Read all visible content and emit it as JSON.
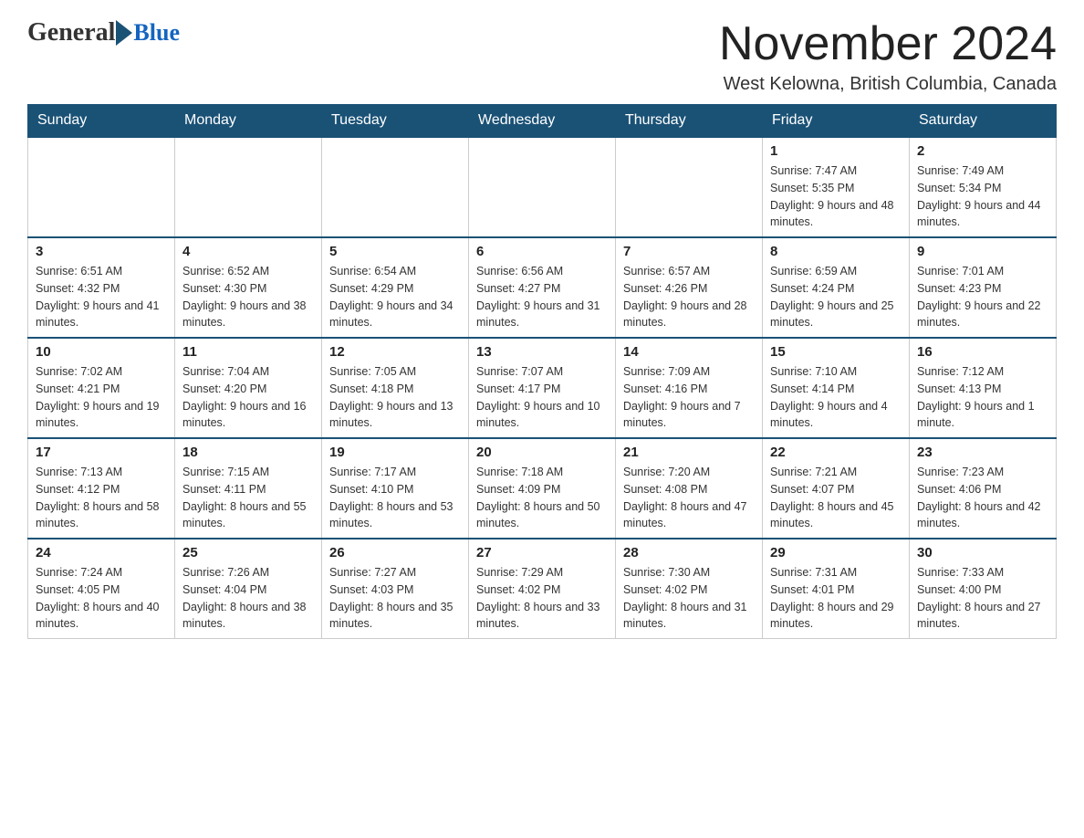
{
  "header": {
    "month_title": "November 2024",
    "location": "West Kelowna, British Columbia, Canada"
  },
  "logo": {
    "part1": "General",
    "part2": "Blue"
  },
  "weekdays": [
    "Sunday",
    "Monday",
    "Tuesday",
    "Wednesday",
    "Thursday",
    "Friday",
    "Saturday"
  ],
  "weeks": [
    [
      {
        "day": "",
        "sunrise": "",
        "sunset": "",
        "daylight": ""
      },
      {
        "day": "",
        "sunrise": "",
        "sunset": "",
        "daylight": ""
      },
      {
        "day": "",
        "sunrise": "",
        "sunset": "",
        "daylight": ""
      },
      {
        "day": "",
        "sunrise": "",
        "sunset": "",
        "daylight": ""
      },
      {
        "day": "",
        "sunrise": "",
        "sunset": "",
        "daylight": ""
      },
      {
        "day": "1",
        "sunrise": "Sunrise: 7:47 AM",
        "sunset": "Sunset: 5:35 PM",
        "daylight": "Daylight: 9 hours and 48 minutes."
      },
      {
        "day": "2",
        "sunrise": "Sunrise: 7:49 AM",
        "sunset": "Sunset: 5:34 PM",
        "daylight": "Daylight: 9 hours and 44 minutes."
      }
    ],
    [
      {
        "day": "3",
        "sunrise": "Sunrise: 6:51 AM",
        "sunset": "Sunset: 4:32 PM",
        "daylight": "Daylight: 9 hours and 41 minutes."
      },
      {
        "day": "4",
        "sunrise": "Sunrise: 6:52 AM",
        "sunset": "Sunset: 4:30 PM",
        "daylight": "Daylight: 9 hours and 38 minutes."
      },
      {
        "day": "5",
        "sunrise": "Sunrise: 6:54 AM",
        "sunset": "Sunset: 4:29 PM",
        "daylight": "Daylight: 9 hours and 34 minutes."
      },
      {
        "day": "6",
        "sunrise": "Sunrise: 6:56 AM",
        "sunset": "Sunset: 4:27 PM",
        "daylight": "Daylight: 9 hours and 31 minutes."
      },
      {
        "day": "7",
        "sunrise": "Sunrise: 6:57 AM",
        "sunset": "Sunset: 4:26 PM",
        "daylight": "Daylight: 9 hours and 28 minutes."
      },
      {
        "day": "8",
        "sunrise": "Sunrise: 6:59 AM",
        "sunset": "Sunset: 4:24 PM",
        "daylight": "Daylight: 9 hours and 25 minutes."
      },
      {
        "day": "9",
        "sunrise": "Sunrise: 7:01 AM",
        "sunset": "Sunset: 4:23 PM",
        "daylight": "Daylight: 9 hours and 22 minutes."
      }
    ],
    [
      {
        "day": "10",
        "sunrise": "Sunrise: 7:02 AM",
        "sunset": "Sunset: 4:21 PM",
        "daylight": "Daylight: 9 hours and 19 minutes."
      },
      {
        "day": "11",
        "sunrise": "Sunrise: 7:04 AM",
        "sunset": "Sunset: 4:20 PM",
        "daylight": "Daylight: 9 hours and 16 minutes."
      },
      {
        "day": "12",
        "sunrise": "Sunrise: 7:05 AM",
        "sunset": "Sunset: 4:18 PM",
        "daylight": "Daylight: 9 hours and 13 minutes."
      },
      {
        "day": "13",
        "sunrise": "Sunrise: 7:07 AM",
        "sunset": "Sunset: 4:17 PM",
        "daylight": "Daylight: 9 hours and 10 minutes."
      },
      {
        "day": "14",
        "sunrise": "Sunrise: 7:09 AM",
        "sunset": "Sunset: 4:16 PM",
        "daylight": "Daylight: 9 hours and 7 minutes."
      },
      {
        "day": "15",
        "sunrise": "Sunrise: 7:10 AM",
        "sunset": "Sunset: 4:14 PM",
        "daylight": "Daylight: 9 hours and 4 minutes."
      },
      {
        "day": "16",
        "sunrise": "Sunrise: 7:12 AM",
        "sunset": "Sunset: 4:13 PM",
        "daylight": "Daylight: 9 hours and 1 minute."
      }
    ],
    [
      {
        "day": "17",
        "sunrise": "Sunrise: 7:13 AM",
        "sunset": "Sunset: 4:12 PM",
        "daylight": "Daylight: 8 hours and 58 minutes."
      },
      {
        "day": "18",
        "sunrise": "Sunrise: 7:15 AM",
        "sunset": "Sunset: 4:11 PM",
        "daylight": "Daylight: 8 hours and 55 minutes."
      },
      {
        "day": "19",
        "sunrise": "Sunrise: 7:17 AM",
        "sunset": "Sunset: 4:10 PM",
        "daylight": "Daylight: 8 hours and 53 minutes."
      },
      {
        "day": "20",
        "sunrise": "Sunrise: 7:18 AM",
        "sunset": "Sunset: 4:09 PM",
        "daylight": "Daylight: 8 hours and 50 minutes."
      },
      {
        "day": "21",
        "sunrise": "Sunrise: 7:20 AM",
        "sunset": "Sunset: 4:08 PM",
        "daylight": "Daylight: 8 hours and 47 minutes."
      },
      {
        "day": "22",
        "sunrise": "Sunrise: 7:21 AM",
        "sunset": "Sunset: 4:07 PM",
        "daylight": "Daylight: 8 hours and 45 minutes."
      },
      {
        "day": "23",
        "sunrise": "Sunrise: 7:23 AM",
        "sunset": "Sunset: 4:06 PM",
        "daylight": "Daylight: 8 hours and 42 minutes."
      }
    ],
    [
      {
        "day": "24",
        "sunrise": "Sunrise: 7:24 AM",
        "sunset": "Sunset: 4:05 PM",
        "daylight": "Daylight: 8 hours and 40 minutes."
      },
      {
        "day": "25",
        "sunrise": "Sunrise: 7:26 AM",
        "sunset": "Sunset: 4:04 PM",
        "daylight": "Daylight: 8 hours and 38 minutes."
      },
      {
        "day": "26",
        "sunrise": "Sunrise: 7:27 AM",
        "sunset": "Sunset: 4:03 PM",
        "daylight": "Daylight: 8 hours and 35 minutes."
      },
      {
        "day": "27",
        "sunrise": "Sunrise: 7:29 AM",
        "sunset": "Sunset: 4:02 PM",
        "daylight": "Daylight: 8 hours and 33 minutes."
      },
      {
        "day": "28",
        "sunrise": "Sunrise: 7:30 AM",
        "sunset": "Sunset: 4:02 PM",
        "daylight": "Daylight: 8 hours and 31 minutes."
      },
      {
        "day": "29",
        "sunrise": "Sunrise: 7:31 AM",
        "sunset": "Sunset: 4:01 PM",
        "daylight": "Daylight: 8 hours and 29 minutes."
      },
      {
        "day": "30",
        "sunrise": "Sunrise: 7:33 AM",
        "sunset": "Sunset: 4:00 PM",
        "daylight": "Daylight: 8 hours and 27 minutes."
      }
    ]
  ]
}
